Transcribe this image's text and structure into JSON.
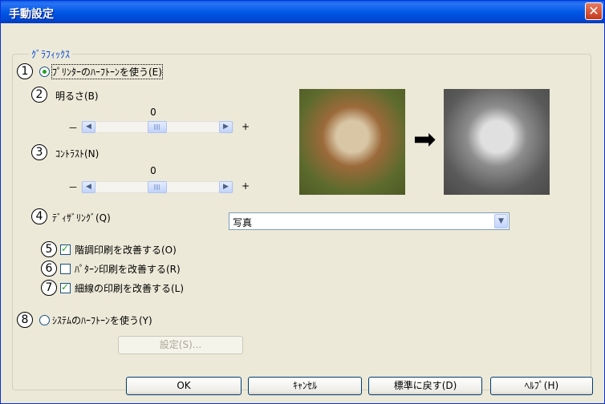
{
  "window": {
    "title": "手動設定",
    "close_glyph": "✕"
  },
  "group": {
    "title": "ｸﾞﾗﾌｨｯｸｽ",
    "printer_halftone_label": "ﾌﾟﾘﾝﾀｰのﾊｰﾌﾄｰﾝを使う(E)",
    "brightness_label": "明るさ(B)",
    "brightness_value": "0",
    "contrast_label": "ｺﾝﾄﾗｽﾄ(N)",
    "contrast_value": "0",
    "minus": "－",
    "plus": "+",
    "dithering_label": "ﾃﾞｨｻﾞﾘﾝｸﾞ(Q)",
    "dithering_value": "写真",
    "improve_gray_label": "階調印刷を改善する(O)",
    "improve_pattern_label": "ﾊﾟﾀｰﾝ印刷を改善する(R)",
    "improve_thin_line_label": "細線の印刷を改善する(L)",
    "system_halftone_label": "ｼｽﾃﾑのﾊｰﾌﾄｰﾝを使う(Y)",
    "settings_button": "設定(S)..."
  },
  "numbers": [
    "1",
    "2",
    "3",
    "4",
    "5",
    "6",
    "7",
    "8"
  ],
  "state": {
    "printer_halftone_selected": true,
    "system_halftone_selected": false,
    "improve_gray_checked": true,
    "improve_pattern_checked": false,
    "improve_thin_line_checked": true,
    "brightness_level": 0,
    "contrast_level": 0
  },
  "arrows": {
    "left": "◀",
    "right": "▶",
    "down": "▼",
    "preview": "➡"
  },
  "buttons": {
    "ok": "OK",
    "cancel": "ｷｬﾝｾﾙ",
    "reset": "標準に戻す(D)",
    "help": "ﾍﾙﾌﾟ(H)"
  },
  "colors": {
    "title_bar": "#0058e6",
    "dialog_bg": "#ece9d8",
    "group_title": "#0046d5",
    "check_mark": "#21a121"
  }
}
